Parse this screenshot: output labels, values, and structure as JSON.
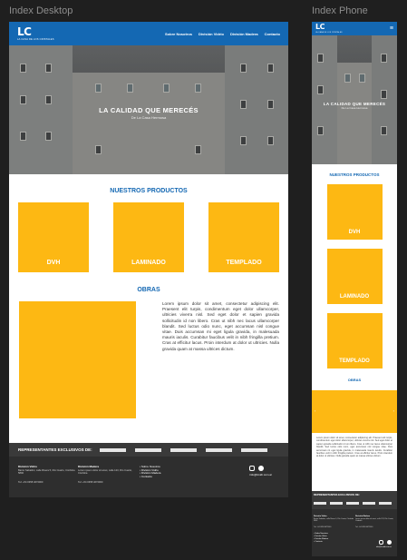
{
  "frames": {
    "desktop_title": "Index Desktop",
    "phone_title": "Index Phone"
  },
  "brand": {
    "logo": "LC",
    "tagline": "LA CASA DE LOS CRISTALES"
  },
  "nav": {
    "items": [
      "Sobre Nosotros",
      "División Vidrio",
      "División Madera",
      "Contacto"
    ]
  },
  "hero": {
    "title": "LA CALIDAD QUE MERECÉS",
    "subtitle": "De La Casa Hermosa"
  },
  "products": {
    "title": "NUESTROS PRODUCTOS",
    "items": [
      {
        "label": "DVH"
      },
      {
        "label": "LAMINADO"
      },
      {
        "label": "TEMPLADO"
      }
    ]
  },
  "obras": {
    "title": "OBRAS",
    "text": "Lorem ipsum dolor sit amet, consectetur adipiscing elit. Praesent elit turpis, condimentum eget dolor ullamcorper, ultricies viverra nisl. Sed eget dolor et sapien gravida sollicitudin id non libero. Cras ut nibh nec lacus ullamcorper blandit. Sed luctus odio nunc, eget accumsan nisl congue vitae. Duis accumsan mi eget ligula gravida, in malesuada mauris iaculis. Curabitur faucibus velit in nibh fringilla pretium. Cras at efficitur lacus. Proin interdum at dolor ut ultricies. Nulla gravida quam at massa ultrices dictum."
  },
  "representantes": {
    "label": "REPRESENTANTES EXCLUSIVOS DE:"
  },
  "footer": {
    "vidrio": {
      "title": "División Vidrio",
      "address": "Barrio Sabattini, calle Rivera 5, Río Cuarto, Córdoba 5800",
      "phone": "Tel: +54 0358 4672000"
    },
    "madera": {
      "title": "División Madera",
      "address": "Lorem ipsum dolor sit amet, calle 123, Río Cuarto, Córdoba",
      "phone": "Tel: +54 0358 4672000"
    },
    "menu": [
      "Sobre Nosotros",
      "División Vidrio",
      "División Madera",
      "Contacto"
    ],
    "email": "info@lcvidr.com.ar"
  },
  "colors": {
    "primary": "#1468b3",
    "accent": "#fdb813",
    "dark": "#2e2e2e",
    "canvas": "#1f1f1f"
  },
  "icons": {
    "menu": "hamburger-icon",
    "instagram": "instagram-icon",
    "facebook": "facebook-icon",
    "prev": "chevron-left-icon",
    "next": "chevron-right-icon"
  }
}
